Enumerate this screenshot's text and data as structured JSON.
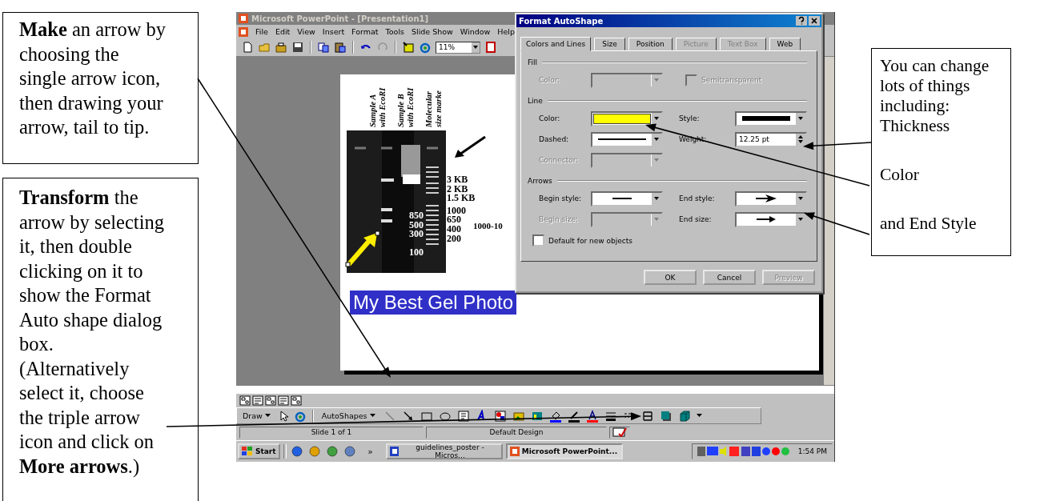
{
  "left_notes": [
    {
      "paragraphs": [
        "**Make** an arrow by choosing the single arrow icon, then drawing your arrow, tail to tip."
      ]
    },
    {
      "paragraphs": [
        "**Transform** the arrow by selecting it, then double clicking on it to show the Format Auto shape dialog box.",
        "(Alternatively select it, choose the triple arrow icon and click on **More arrows**.)"
      ]
    }
  ],
  "app_window": {
    "title": "Microsoft PowerPoint - [Presentation1]",
    "menu": [
      "File",
      "Edit",
      "View",
      "Insert",
      "Format",
      "Tools",
      "Slide Show",
      "Window",
      "Help"
    ],
    "zoom": "11%",
    "slide": {
      "lane_labels": [
        "Sample A with EcoRI",
        "Sample B with EcoRI",
        "Molecular size marke"
      ],
      "photo_labels": [
        "850",
        "500",
        "300",
        "100"
      ],
      "marker_labels": [
        "3 KB",
        "2 KB",
        "1.5 KB",
        "1000",
        "650",
        "400",
        "200"
      ],
      "side_note": "1000-10",
      "caption": {
        "text": "My Best Gel Photo",
        "selected": true
      }
    },
    "drawing_toolbar": {
      "draw": "Draw",
      "autoshapes": "AutoShapes"
    },
    "status_bar": [
      "Slide 1 of 1",
      "Default Design"
    ],
    "taskbar": {
      "start": "Start",
      "more": "»",
      "tasks": [
        {
          "label": "guidelines_poster - Micros...",
          "selected": false
        },
        {
          "label": "Microsoft PowerPoint...",
          "selected": true
        }
      ],
      "clock": "1:54 PM"
    }
  },
  "dialog": {
    "title": "Format AutoShape",
    "tabs": [
      {
        "label": "Colors and Lines",
        "selected": true,
        "disabled": false
      },
      {
        "label": "Size",
        "selected": false,
        "disabled": false
      },
      {
        "label": "Position",
        "selected": false,
        "disabled": false
      },
      {
        "label": "Picture",
        "selected": false,
        "disabled": true
      },
      {
        "label": "Text Box",
        "selected": false,
        "disabled": true
      },
      {
        "label": "Web",
        "selected": false,
        "disabled": false
      }
    ],
    "sections": [
      {
        "title": "Fill",
        "rows": [
          [
            {
              "kind": "empty",
              "label": "Color:",
              "disabled": true
            },
            {
              "kind": "checkbox",
              "label": "Semitransparent",
              "checked": false,
              "disabled": true
            }
          ]
        ]
      },
      {
        "title": "Line",
        "rows": [
          [
            {
              "kind": "swatch",
              "label": "Color:",
              "color": "#ffff00",
              "disabled": false
            },
            {
              "kind": "thickline",
              "label": "Style:",
              "disabled": false
            }
          ],
          [
            {
              "kind": "thinline",
              "label": "Dashed:",
              "disabled": false
            },
            {
              "kind": "spinner",
              "label": "Weight:",
              "value": "12.25 pt",
              "disabled": false
            }
          ],
          [
            {
              "kind": "empty",
              "label": "Connector:",
              "disabled": true
            }
          ]
        ]
      },
      {
        "title": "Arrows",
        "rows": [
          [
            {
              "kind": "plainline",
              "label": "Begin style:",
              "disabled": false
            },
            {
              "kind": "arrowhead",
              "label": "End style:",
              "disabled": false
            }
          ],
          [
            {
              "kind": "empty",
              "label": "Begin size:",
              "disabled": true
            },
            {
              "kind": "smallarrow",
              "label": "End size:",
              "disabled": false
            }
          ]
        ]
      }
    ],
    "default_checkbox": {
      "label": "Default for new objects",
      "checked": false
    },
    "buttons": [
      {
        "label": "OK",
        "disabled": false
      },
      {
        "label": "Cancel",
        "disabled": false
      },
      {
        "label": "Preview",
        "disabled": true
      }
    ]
  },
  "right_note": {
    "lines": [
      "You can change lots of things including:",
      "Thickness",
      "Color",
      "and End Style"
    ]
  }
}
